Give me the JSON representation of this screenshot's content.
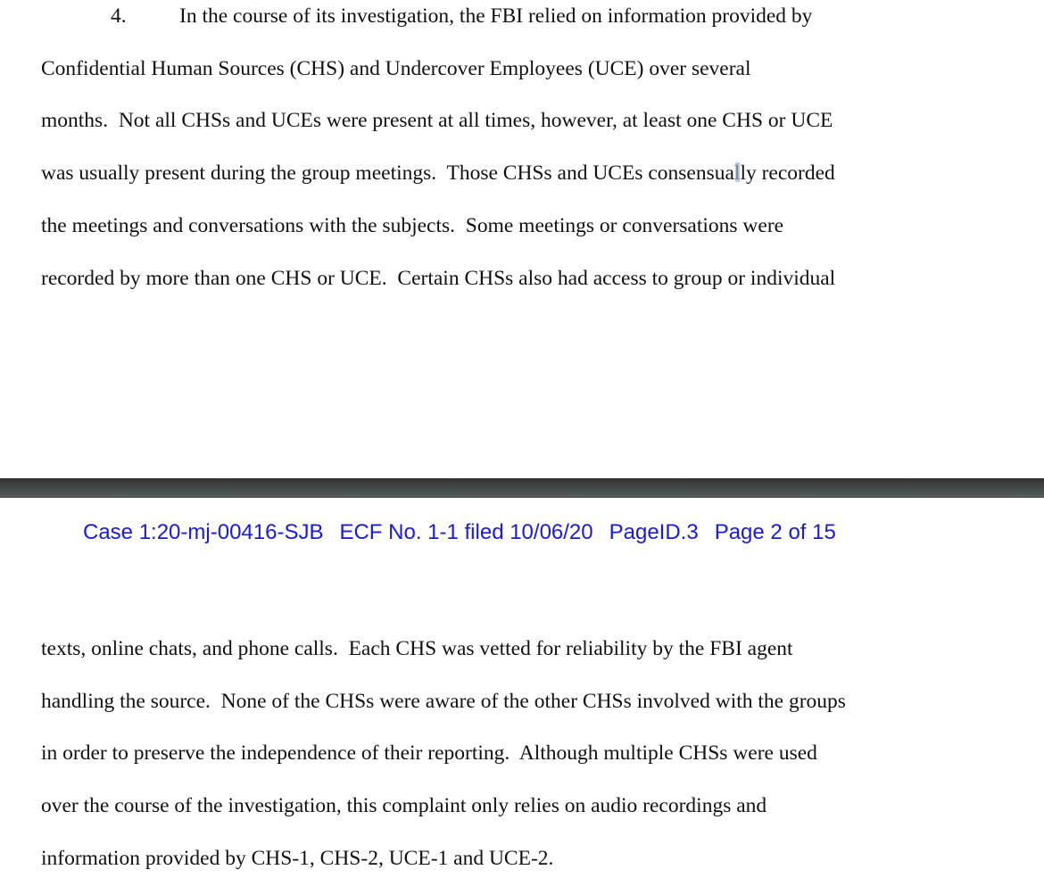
{
  "document": {
    "page_top": {
      "paragraph_number": "4.",
      "lines": [
        "In the course of its investigation, the FBI relied on information provided by",
        "Confidential Human Sources (CHS) and Undercover Employees (UCE) over several",
        "months.  Not all CHSs and UCEs were present at all times, however, at least one CHS or UCE",
        "was usually present during the group meetings.  Those CHSs and UCEs consensually recorded",
        "the meetings and conversations with the subjects.  Some meetings or conversations were",
        "recorded by more than one CHS or UCE.  Certain CHSs also had access to group or individual"
      ],
      "line4_before_cursor": "was usually present during the group meetings.  Those CHSs and UCEs consensual",
      "line4_after_cursor": "ly recorded"
    },
    "ecf_header": {
      "case": "Case 1:20-mj-00416-SJB",
      "ecf": "ECF No. 1-1 filed 10/06/20",
      "page_id": "PageID.3",
      "page": "Page 2 of 15",
      "color": "#1a1adb"
    },
    "page_bottom": {
      "lines": [
        "texts, online chats, and phone calls.  Each CHS was vetted for reliability by the FBI agent",
        "handling the source.  None of the CHSs were aware of the other CHSs involved with the groups",
        "in order to preserve the independence of their reporting.  Although multiple CHSs were used",
        "over the course of the investigation, this complaint only relies on audio recordings and",
        "information provided by CHS-1, CHS-2, UCE-1 and UCE-2."
      ]
    }
  }
}
